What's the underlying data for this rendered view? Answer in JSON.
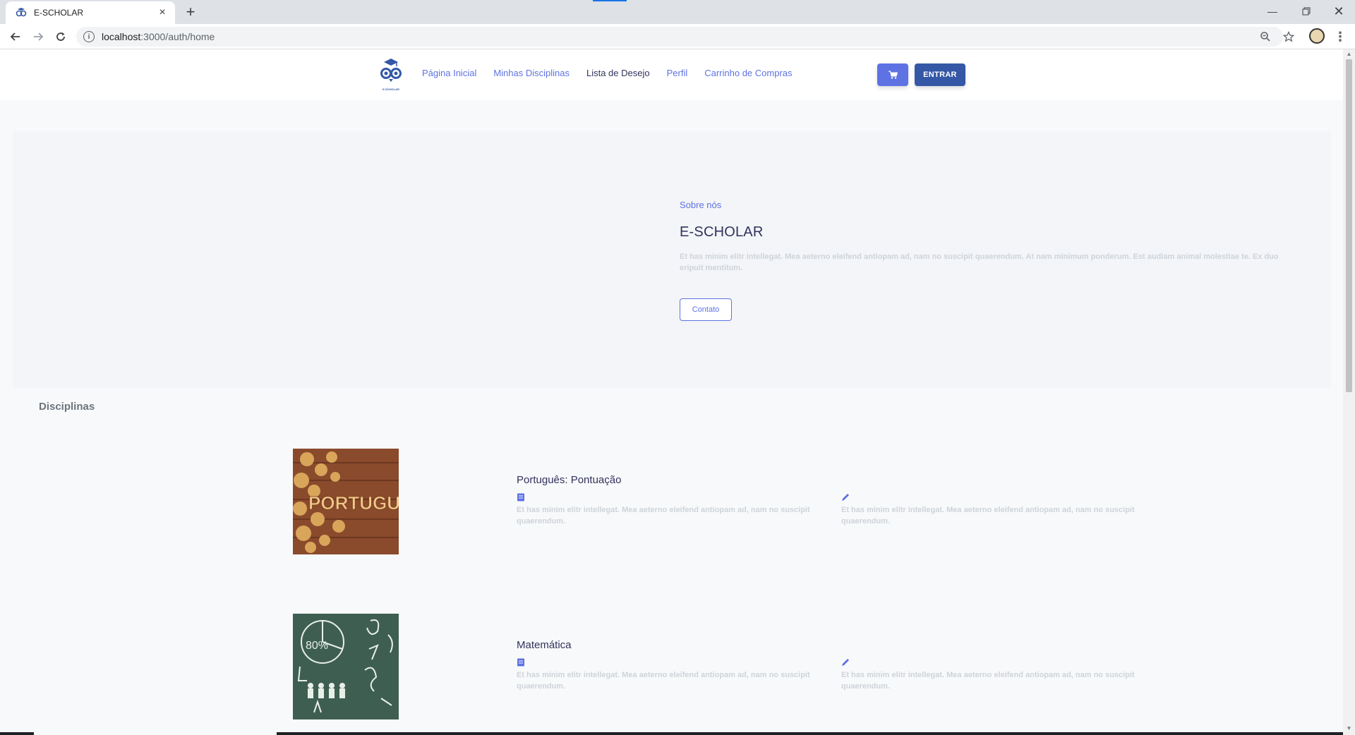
{
  "browser": {
    "tab_title": "E-SCHOLAR",
    "url_host": "localhost",
    "url_rest": ":3000/auth/home"
  },
  "header": {
    "nav": [
      "Página Inicial",
      "Minhas Disciplinas",
      "Lista de Desejo",
      "Perfil",
      "Carrinho de Compras"
    ],
    "login_label": "ENTRAR",
    "logo_text": "E-SCHOLAR"
  },
  "hero": {
    "eyebrow": "Sobre nós",
    "title": "E-SCHOLAR",
    "text": "Et has minim elitr intellegat. Mea aeterno eleifend antiopam ad, nam no suscipit quaerendum. At nam minimum ponderum. Est audiam animal molestiae te. Ex duo eripuit mentitum.",
    "button": "Contato"
  },
  "section": {
    "title": "Disciplinas"
  },
  "courses": [
    {
      "name": "Português: Pontuação",
      "image_text": "PORTUGU",
      "desc_left": "Et has minim elitr intellegat. Mea aeterno eleifend antiopam ad, nam no suscipit quaerendum.",
      "desc_right": "Et has minim elitr intellegat. Mea aeterno eleifend antiopam ad, nam no suscipit quaerendum."
    },
    {
      "name": "Matemática",
      "image_text": "80%",
      "desc_left": "Et has minim elitr intellegat. Mea aeterno eleifend antiopam ad, nam no suscipit quaerendum.",
      "desc_right": "Et has minim elitr intellegat. Mea aeterno eleifend antiopam ad, nam no suscipit quaerendum."
    }
  ],
  "colors": {
    "primary": "#5e72e4",
    "dark_button": "#3458a6",
    "heading": "#32325d",
    "muted_text": "#ced4da"
  }
}
